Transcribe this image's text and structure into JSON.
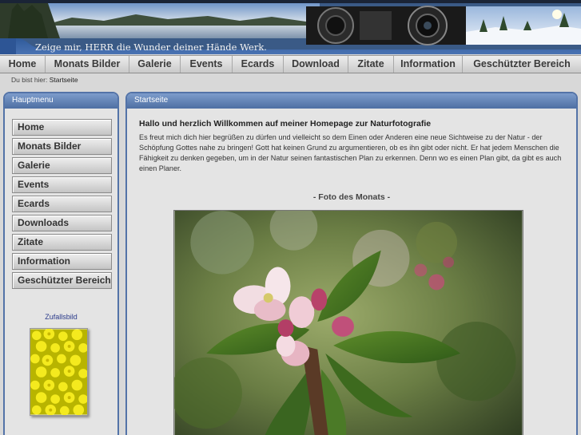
{
  "header": {
    "slogan": "Zeige mir, HERR die Wunder deiner Hände Werk."
  },
  "nav": {
    "items": [
      {
        "label": "Home"
      },
      {
        "label": "Monats Bilder"
      },
      {
        "label": "Galerie"
      },
      {
        "label": "Events"
      },
      {
        "label": "Ecards"
      },
      {
        "label": "Download"
      },
      {
        "label": "Zitate"
      },
      {
        "label": "Information"
      },
      {
        "label": "Geschützter Bereich"
      }
    ]
  },
  "breadcrumb": {
    "prefix": "Du bist hier:",
    "current": "Startseite"
  },
  "sidebar": {
    "title": "Hauptmenu",
    "items": [
      {
        "label": "Home"
      },
      {
        "label": "Monats Bilder"
      },
      {
        "label": "Galerie"
      },
      {
        "label": "Events"
      },
      {
        "label": "Ecards"
      },
      {
        "label": "Downloads"
      },
      {
        "label": "Zitate"
      },
      {
        "label": "Information"
      },
      {
        "label": "Geschützter Bereich"
      }
    ],
    "random_label": "Zufallsbild"
  },
  "main": {
    "title": "Startseite",
    "welcome_heading": "Hallo und herzlich Willkommen auf meiner Homepage zur Naturfotografie",
    "welcome_text": "Es freut mich dich hier begrüßen zu dürfen und vielleicht so dem Einen oder Anderen eine neue Sichtweise zu der Natur - der Schöpfung Gottes nahe zu bringen! Gott hat keinen Grund zu argumentieren, ob es ihn gibt oder nicht. Er hat jedem Menschen die Fähigkeit zu denken gegeben, um in der Natur seinen fantastischen Plan zu erkennen. Denn wo es einen Plan gibt, da gibt es auch einen Planer.",
    "photo_heading": "- Foto des Monats -"
  },
  "colors": {
    "panel_border": "#5373a8",
    "panel_header": "#6384b8",
    "link": "#2a3a8a"
  }
}
